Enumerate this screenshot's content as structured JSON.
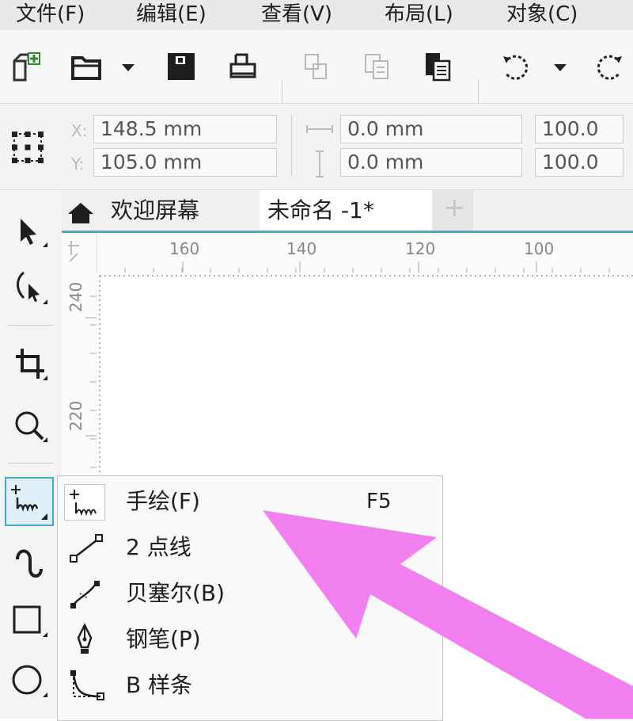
{
  "menubar": {
    "items": [
      "文件(F)",
      "编辑(E)",
      "查看(V)",
      "布局(L)",
      "对象(C)"
    ]
  },
  "toolbar": {
    "icons": [
      "new-document-icon",
      "open-folder-icon",
      "dropdown-arrow-icon",
      "save-icon",
      "print-icon",
      "copy-icon",
      "duplicate-icon",
      "paste-icon",
      "undo-icon",
      "dropdown-arrow-icon",
      "redo-icon"
    ]
  },
  "propbar": {
    "x_label": "X:",
    "x_value": "148.5 mm",
    "y_label": "Y:",
    "y_value": "105.0 mm",
    "width_value": "0.0 mm",
    "height_value": "0.0 mm",
    "scale_x": "100.0",
    "scale_y": "100.0"
  },
  "tabs": {
    "welcome": "欢迎屏幕",
    "document": "未命名 -1*",
    "add": "+"
  },
  "ruler": {
    "top_labels": [
      "160",
      "140",
      "120",
      "100"
    ],
    "left_labels": [
      "240",
      "220"
    ]
  },
  "flyout": {
    "items": [
      {
        "label": "手绘(F)",
        "shortcut": "F5",
        "icon": "freehand-icon"
      },
      {
        "label": "2 点线",
        "shortcut": "",
        "icon": "two-point-line-icon"
      },
      {
        "label": "贝塞尔(B)",
        "shortcut": "",
        "icon": "bezier-icon"
      },
      {
        "label": "钢笔(P)",
        "shortcut": "",
        "icon": "pen-icon"
      },
      {
        "label": "B 样条",
        "shortcut": "",
        "icon": "b-spline-icon"
      }
    ]
  },
  "colors": {
    "accent": "#44a8d6",
    "arrow": "#f27ff0",
    "selected_tool_bg": "#dff0f8"
  }
}
